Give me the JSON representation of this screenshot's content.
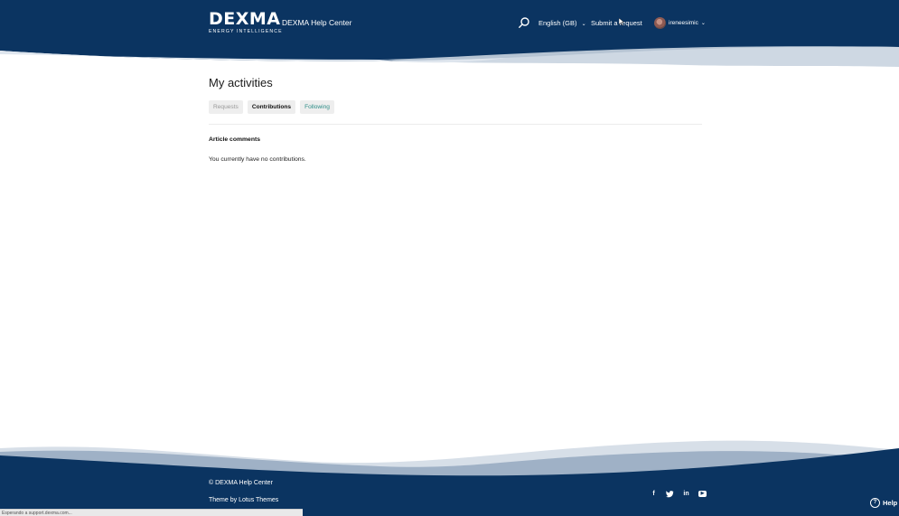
{
  "header": {
    "logo": {
      "brand": "DEXMA",
      "tagline": "ENERGY INTELLIGENCE"
    },
    "site_name": "DEXMA Help Center",
    "search_icon": "search-icon",
    "language": "English (GB)",
    "submit_request": "Submit a request",
    "user": {
      "name": "ireneesimic"
    }
  },
  "main": {
    "title": "My activities",
    "tabs": [
      {
        "label": "Requests",
        "state": "disabled"
      },
      {
        "label": "Contributions",
        "state": "selected"
      },
      {
        "label": "Following",
        "state": "link"
      }
    ],
    "section_title": "Article comments",
    "empty_message": "You currently have no contributions."
  },
  "footer": {
    "copyright": "© DEXMA Help Center",
    "theme": "Theme by Lotus Themes",
    "socials": [
      "facebook-icon",
      "twitter-icon",
      "linkedin-icon",
      "youtube-icon"
    ],
    "help_label": "Help"
  },
  "status_bar": "Esperando a support.dexma.com...",
  "colors": {
    "navy": "#0b3461",
    "wave": "#c9d4e0",
    "accent": "#2c8c86",
    "tab_bg": "#eeeeee"
  }
}
